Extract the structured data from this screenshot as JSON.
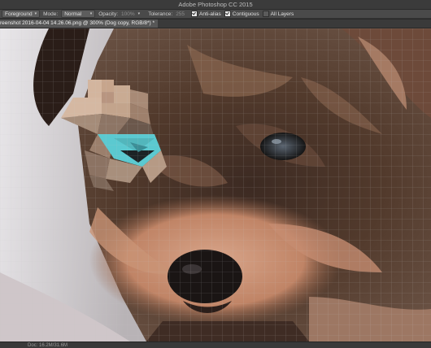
{
  "window": {
    "title": "Adobe Photoshop CC 2015"
  },
  "options_bar": {
    "fill_source": "Foreground",
    "mode_label": "Mode:",
    "mode_value": "Normal",
    "opacity_label": "Opacity:",
    "opacity_value": "100%",
    "tolerance_label": "Tolerance:",
    "tolerance_value": "255",
    "anti_alias": {
      "label": "Anti-alias",
      "checked": true
    },
    "contiguous": {
      "label": "Contiguous",
      "checked": true
    },
    "all_layers": {
      "label": "All Layers",
      "checked": false
    }
  },
  "document_tab": {
    "label": "reenshot 2016-04-04 14.26.06.png @ 300% (Dog copy, RGB/8*) *",
    "close_icon": "close-icon"
  },
  "status_bar": {
    "doc_info": "Doc: 16.2M/31.6M"
  },
  "colors": {
    "lowpoly_cyan": "#5bc9d0",
    "lowpoly_tan": "#c9a98f",
    "grid_line": "#bfbfbf"
  }
}
